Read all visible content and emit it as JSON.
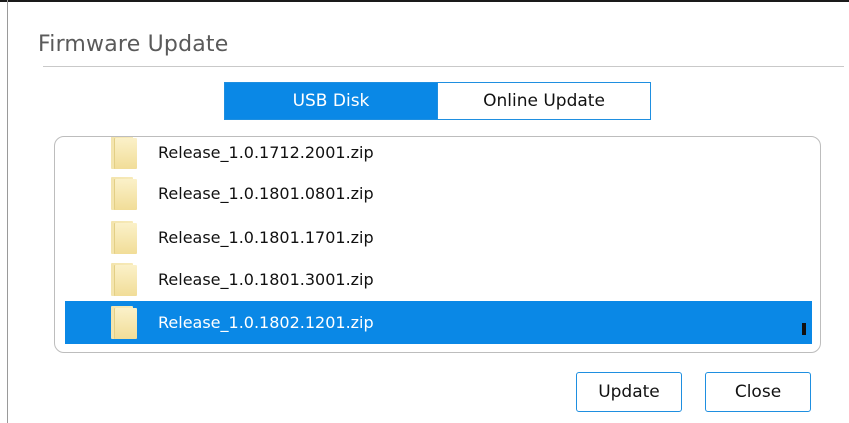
{
  "dialog": {
    "title": "Firmware Update"
  },
  "tabs": [
    {
      "label": "USB Disk",
      "active": true
    },
    {
      "label": "Online Update",
      "active": false
    }
  ],
  "files": [
    {
      "name": "Release_1.0.1712.2001.zip",
      "selected": false
    },
    {
      "name": "Release_1.0.1801.0801.zip",
      "selected": false
    },
    {
      "name": "Release_1.0.1801.1701.zip",
      "selected": false
    },
    {
      "name": "Release_1.0.1801.3001.zip",
      "selected": false
    },
    {
      "name": "Release_1.0.1802.1201.zip",
      "selected": true
    }
  ],
  "buttons": {
    "update_label": "Update",
    "close_label": "Close"
  },
  "colors": {
    "accent": "#0a88e6",
    "selected_text": "#ffffff",
    "title_text": "#5a5a5a"
  },
  "icons": {
    "file": "folder-icon"
  }
}
